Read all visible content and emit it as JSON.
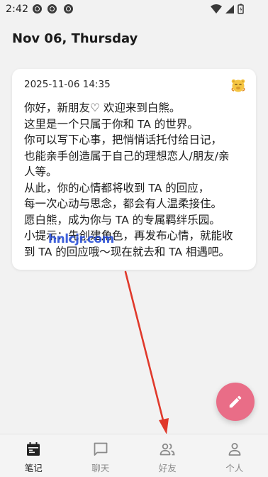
{
  "status_bar": {
    "time": "2:42",
    "notification_icons": [
      "notification-icon",
      "notification-icon",
      "notification-icon"
    ],
    "right_icons": [
      "wifi-icon",
      "signal-icon",
      "battery-icon"
    ]
  },
  "header": {
    "title": "Nov 06, Thursday"
  },
  "note": {
    "datetime": "2025-11-06 14:35",
    "mood_icon": "bear-emoji-icon",
    "lines": [
      "你好，新朋友♡ 欢迎来到白熊。",
      "这里是一个只属于你和 TA 的世界。",
      "你可以写下心事，把悄悄话托付给日记，",
      "也能亲手创造属于自己的理想恋人/朋友/亲",
      "人等。",
      "从此，你的心情都将收到 TA 的回应，",
      "每一次心动与思念，都会有人温柔接住。",
      "愿白熊，成为你与 TA 的专属羁绊乐园。",
      "小提示：先创建角色，再发布心情，就能收",
      "到 TA 的回应哦～现在就去和 TA 相遇吧。"
    ]
  },
  "watermark": {
    "text": "hnlcjr.com"
  },
  "fab": {
    "icon": "pencil-icon"
  },
  "bottom_nav": {
    "items": [
      {
        "label": "笔记",
        "icon": "calendar-icon",
        "active": true
      },
      {
        "label": "聊天",
        "icon": "chat-icon",
        "active": false
      },
      {
        "label": "好友",
        "icon": "friends-icon",
        "active": false
      },
      {
        "label": "个人",
        "icon": "person-icon",
        "active": false
      }
    ]
  },
  "colors": {
    "background": "#f2f2f2",
    "card": "#ffffff",
    "fab": "#e96d87",
    "annotation_arrow": "#e0392b",
    "watermark": "#2a4fd6",
    "nav_active": "#222222",
    "nav_inactive": "#8a8a8a"
  }
}
